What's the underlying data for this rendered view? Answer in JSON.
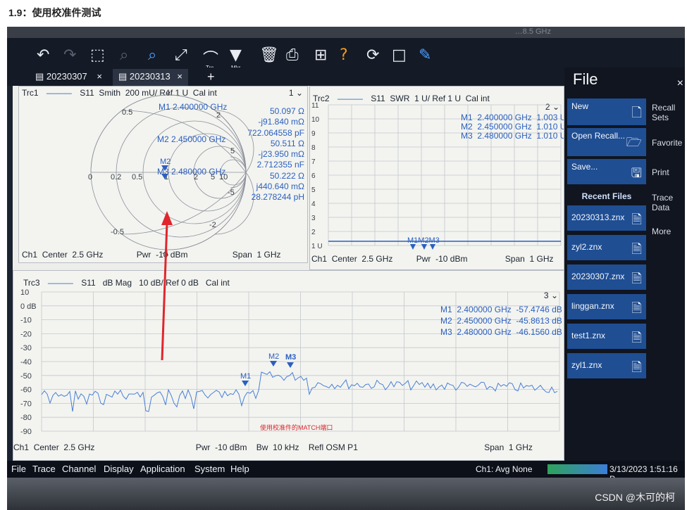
{
  "page_heading": "1.9：使用校准件测试",
  "bezel_label": "…8.5 GHz",
  "toolbar": {
    "trace_label": "Trc",
    "marker_label": "Mkr"
  },
  "tabs": [
    {
      "label": "20230307",
      "close": "×"
    },
    {
      "label": "20230313",
      "close": "×"
    },
    {
      "label": "+"
    }
  ],
  "trc1": {
    "header": "Trc1",
    "param": "S11",
    "format": "Smith",
    "scale": "200 mU/ Ref 1 U",
    "cal": "Cal int",
    "window": "1",
    "marker_lines": [
      {
        "label": "M1 2.400000 GHz"
      },
      {
        "label": "M2 2.450000 GHz"
      },
      {
        "label": "M3 2.480000 GHz"
      }
    ],
    "marker_values": [
      "50.097 Ω",
      "-j91.840 mΩ",
      "722.064558 pF",
      "50.511 Ω",
      "-j23.950 mΩ",
      "2.712355 nF",
      "50.222 Ω",
      "j440.640 mΩ",
      "28.278244 pH"
    ],
    "smith_labels": {
      "r0": "0",
      "r02": "0.2",
      "r05": "0.5",
      "r1": "1",
      "r2": "2",
      "r5": "5",
      "r10": "10",
      "x05": "0.5",
      "x1": "1",
      "x2": "2",
      "x5": "5",
      "xm05": "-0.5",
      "xm1": "-1",
      "xm2": "-2",
      "xm5": "-5"
    },
    "marker_tag_top": "M2",
    "footer": {
      "ch": "Ch1",
      "center": "Center",
      "center_val": "2.5 GHz",
      "pwr": "Pwr",
      "pwr_val": "-10 dBm",
      "span": "Span",
      "span_val": "1 GHz"
    }
  },
  "trc2": {
    "header": "Trc2",
    "param": "S11",
    "format": "SWR",
    "scale": "1 U/ Ref 1 U",
    "cal": "Cal int",
    "window": "2",
    "y_ticks": [
      "11",
      "10",
      "9",
      "8",
      "7",
      "6",
      "5",
      "4",
      "3",
      "2",
      "1 U"
    ],
    "markers": [
      {
        "name": "M1",
        "freq": "2.400000 GHz",
        "value": "1.003 U"
      },
      {
        "name": "M2",
        "freq": "2.450000 GHz",
        "value": "1.010 U"
      },
      {
        "name": "M3",
        "freq": "2.480000 GHz",
        "value": "1.010 U"
      }
    ],
    "marker_tags": "M1M2M3",
    "footer": {
      "ch": "Ch1",
      "center": "Center",
      "center_val": "2.5 GHz",
      "pwr": "Pwr",
      "pwr_val": "-10 dBm",
      "span": "Span",
      "span_val": "1 GHz"
    }
  },
  "trc3": {
    "header": "Trc3",
    "param": "S11",
    "format": "dB Mag",
    "scale": "10 dB/ Ref 0 dB",
    "cal": "Cal int",
    "window": "3",
    "y_ticks": [
      "10",
      "0 dB",
      "-10",
      "-20",
      "-30",
      "-40",
      "-50",
      "-60",
      "-70",
      "-80",
      "-90"
    ],
    "markers": [
      {
        "name": "M1",
        "freq": "2.400000 GHz",
        "value": "-57.4746 dB"
      },
      {
        "name": "M2",
        "freq": "2.450000 GHz",
        "value": "-45.8613 dB"
      },
      {
        "name": "M3",
        "freq": "2.480000 GHz",
        "value": "-46.1560 dB"
      }
    ],
    "note": "使用校准件的MATCH端口",
    "footer": {
      "ch": "Ch1",
      "center": "Center",
      "center_val": "2.5 GHz",
      "pwr": "Pwr",
      "pwr_val": "-10 dBm",
      "bw": "Bw",
      "bw_val": "10 kHz",
      "refl": "Refl OSM P1",
      "span": "Span",
      "span_val": "1 GHz"
    }
  },
  "side_panel": {
    "title": "File",
    "buttons": [
      "New",
      "Open Recall...",
      "Save..."
    ],
    "recent_title": "Recent Files",
    "recent_files": [
      "20230313.znx",
      "zyl2.znx",
      "20230307.znx",
      "linggan.znx",
      "test1.znx",
      "zyl1.znx"
    ],
    "right_column": [
      "Recall Sets",
      "Favorite",
      "Print",
      "Trace Data",
      "More"
    ]
  },
  "menubar": {
    "items": [
      "File",
      "Trace",
      "Channel",
      "Display",
      "Application",
      "System",
      "Help"
    ],
    "avg": "Ch1: Avg None",
    "datetime": "3/13/2023 1:51:16 P"
  },
  "watermark": "CSDN @木可的柯"
}
